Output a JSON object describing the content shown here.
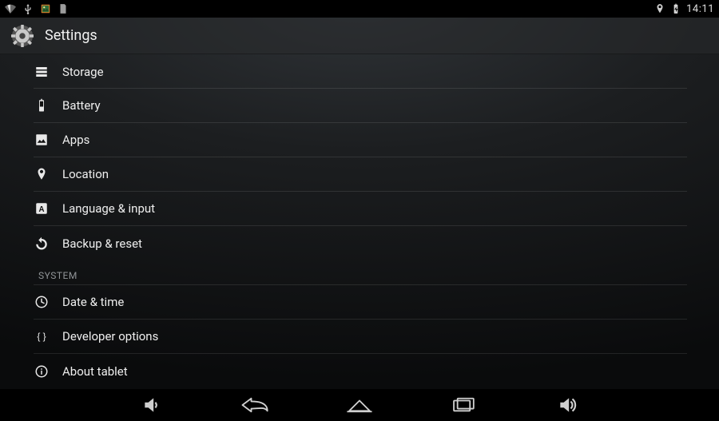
{
  "statusbar": {
    "clock": "14:11"
  },
  "actionbar": {
    "title": "Settings"
  },
  "settings": {
    "items": [
      {
        "icon": "storage-icon",
        "label": "Storage"
      },
      {
        "icon": "battery-icon",
        "label": "Battery"
      },
      {
        "icon": "apps-icon",
        "label": "Apps"
      },
      {
        "icon": "location-icon",
        "label": "Location"
      },
      {
        "icon": "language-icon",
        "label": "Language & input"
      },
      {
        "icon": "backup-icon",
        "label": "Backup & reset"
      }
    ],
    "section_system": "SYSTEM",
    "system_items": [
      {
        "icon": "clock-icon",
        "label": "Date & time"
      },
      {
        "icon": "dev-icon",
        "label": "Developer options"
      },
      {
        "icon": "about-icon",
        "label": "About tablet"
      }
    ]
  }
}
